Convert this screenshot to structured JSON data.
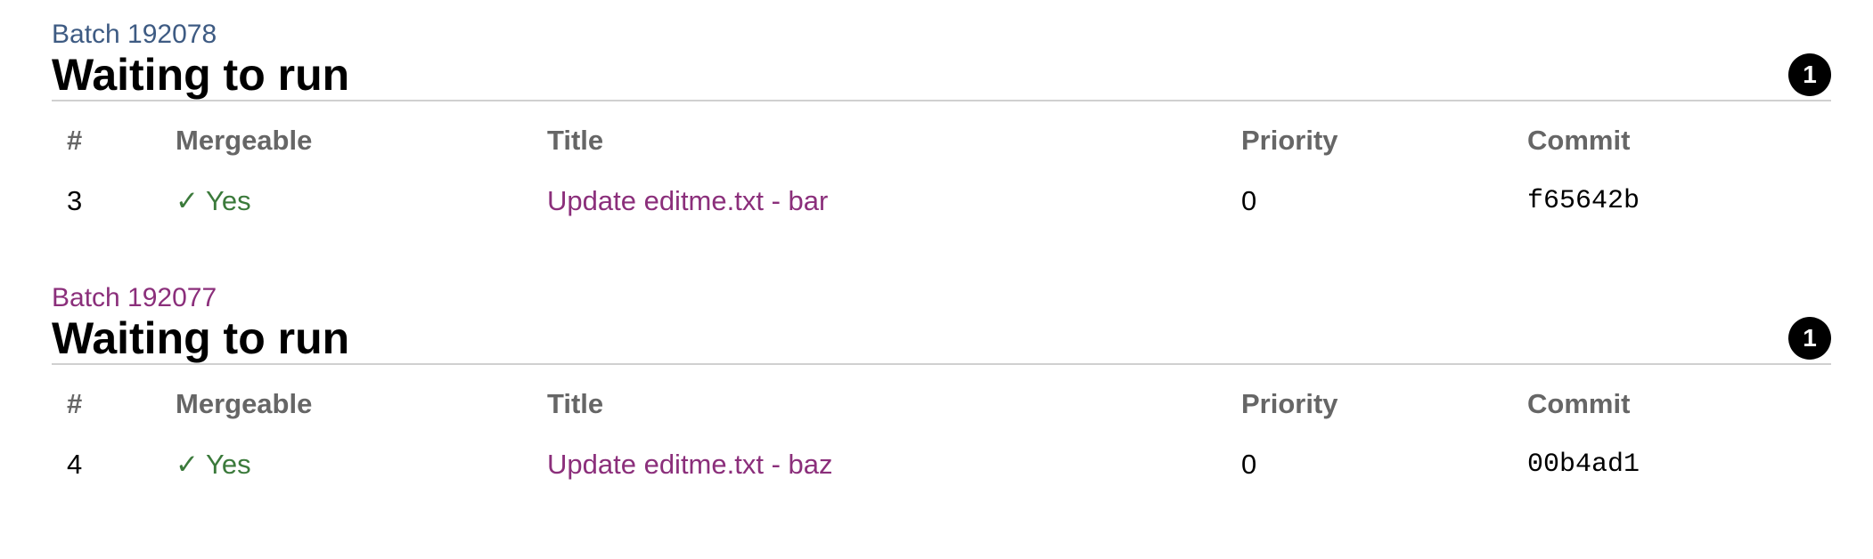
{
  "columns": {
    "num": "#",
    "mergeable": "Mergeable",
    "title": "Title",
    "priority": "Priority",
    "commit": "Commit"
  },
  "colors": {
    "visited_link": "#3e5b83",
    "link": "#8b2f7b",
    "mergeable_yes": "#3b7a3b",
    "header_text": "#666666"
  },
  "batches": [
    {
      "label": "Batch 192078",
      "status": "Waiting to run",
      "count": "1",
      "rows": [
        {
          "num": "3",
          "mergeable": "✓ Yes",
          "title": "Update editme.txt - bar",
          "priority": "0",
          "commit": "f65642b"
        }
      ]
    },
    {
      "label": "Batch 192077",
      "status": "Waiting to run",
      "count": "1",
      "rows": [
        {
          "num": "4",
          "mergeable": "✓ Yes",
          "title": "Update editme.txt - baz",
          "priority": "0",
          "commit": "00b4ad1"
        }
      ]
    }
  ]
}
